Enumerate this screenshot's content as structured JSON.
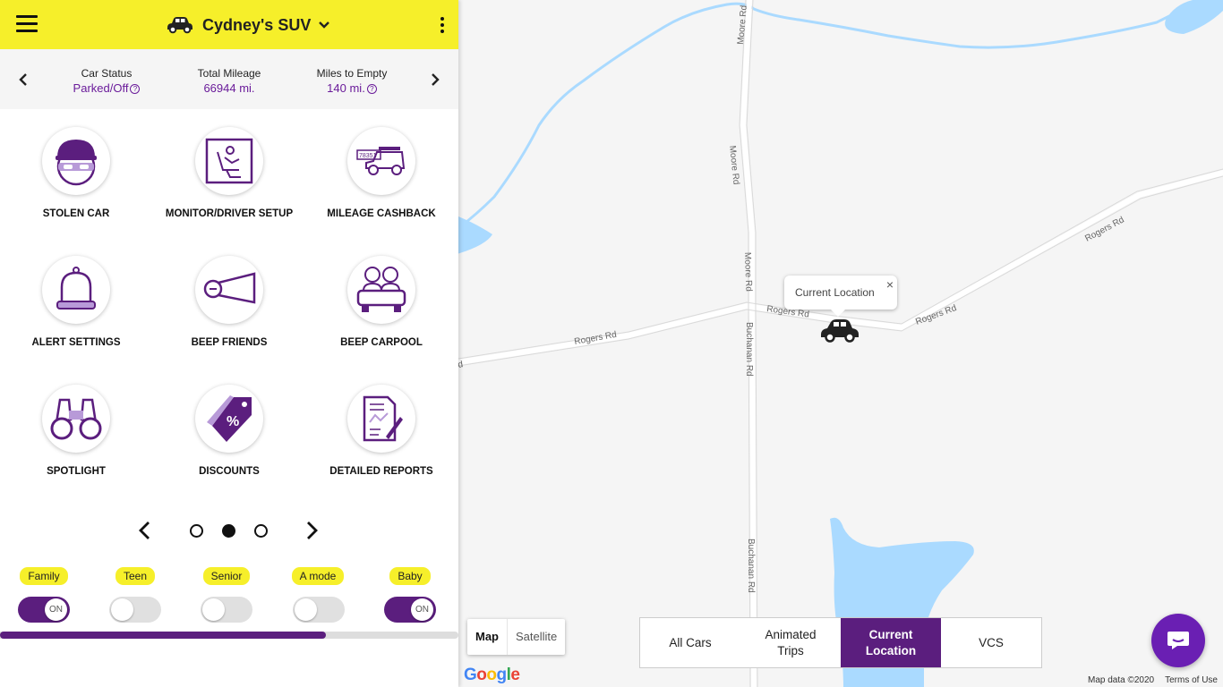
{
  "header": {
    "menu_icon": "hamburger-menu-icon",
    "car_name": "Cydney's SUV",
    "dropdown_icon": "chevron-down-icon",
    "more_icon": "vertical-dots-icon",
    "accent_color": "#f6ef2a",
    "brand_color": "#5b1e7e"
  },
  "stats": [
    {
      "label": "Car Status",
      "value": "Parked/Off",
      "help": "?"
    },
    {
      "label": "Total Mileage",
      "value": "66944 mi.",
      "help": ""
    },
    {
      "label": "Miles to Empty",
      "value": "140 mi.",
      "help": "?"
    }
  ],
  "tiles": [
    {
      "label": "STOLEN CAR",
      "icon": "masked-thief-icon"
    },
    {
      "label": "MONITOR/DRIVER SETUP",
      "icon": "driver-seat-icon"
    },
    {
      "label": "MILEAGE CASHBACK",
      "icon": "odometer-jeep-icon"
    },
    {
      "label": "ALERT SETTINGS",
      "icon": "bell-icon"
    },
    {
      "label": "BEEP FRIENDS",
      "icon": "megaphone-icon"
    },
    {
      "label": "BEEP CARPOOL",
      "icon": "carpool-icon"
    },
    {
      "label": "SPOTLIGHT",
      "icon": "binoculars-icon"
    },
    {
      "label": "DISCOUNTS",
      "icon": "discount-tag-icon"
    },
    {
      "label": "DETAILED REPORTS",
      "icon": "report-document-icon"
    }
  ],
  "pager": {
    "pages": 3,
    "current": 2
  },
  "modes": [
    {
      "label": "Family",
      "on": true,
      "state_text": "ON"
    },
    {
      "label": "Teen",
      "on": false,
      "state_text": ""
    },
    {
      "label": "Senior",
      "on": false,
      "state_text": ""
    },
    {
      "label": "A mode",
      "on": false,
      "state_text": ""
    },
    {
      "label": "Baby",
      "on": true,
      "state_text": "ON"
    }
  ],
  "progress": {
    "fraction": 0.71
  },
  "map": {
    "roads": {
      "moore_rd": "Moore Rd",
      "rogers_rd": "Rogers Rd",
      "buchanan_rd": "Buchanan Rd",
      "cut_label": "d"
    },
    "info_window": {
      "text": "Current Location",
      "close": "×"
    },
    "map_types": {
      "map": "Map",
      "satellite": "Satellite"
    },
    "views": [
      {
        "label": "All Cars",
        "active": false
      },
      {
        "label": "Animated\nTrips",
        "active": false
      },
      {
        "label": "Current\nLocation",
        "active": true
      },
      {
        "label": "VCS",
        "active": false
      }
    ],
    "google": "Google",
    "map_data": "Map data ©2020",
    "terms": "Terms of Use",
    "water_color": "#aadaff"
  }
}
